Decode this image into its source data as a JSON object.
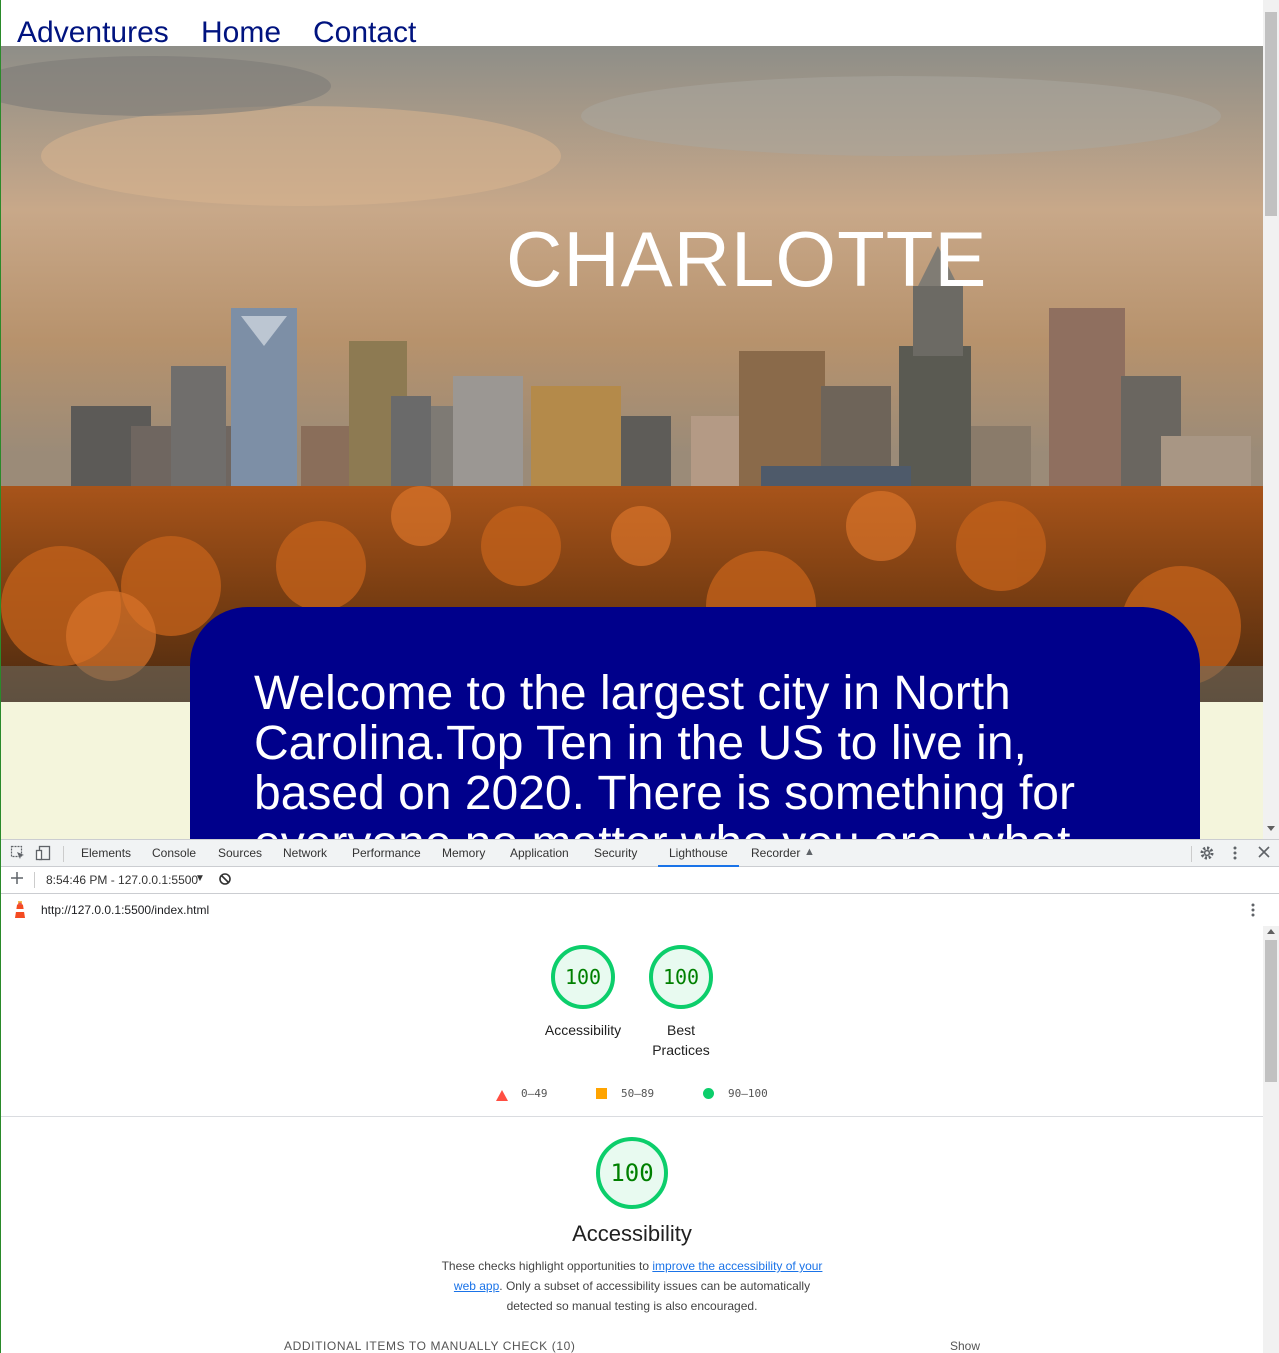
{
  "nav": {
    "adventures": "Adventures",
    "home": "Home",
    "contact": "Contact"
  },
  "hero": {
    "title": "CHARLOTTE"
  },
  "welcome": {
    "text": "Welcome to the largest city in North Carolina.Top Ten in the US to live in, based on 2020. There is something for everyone no matter who you are, what"
  },
  "devtools": {
    "tabs": [
      "Elements",
      "Console",
      "Sources",
      "Network",
      "Performance",
      "Memory",
      "Application",
      "Security",
      "Lighthouse",
      "Recorder"
    ],
    "active_tab": "Lighthouse",
    "report_select": "8:54:46 PM - 127.0.0.1:5500",
    "url": "http://127.0.0.1:5500/index.html"
  },
  "lighthouse": {
    "scores": [
      {
        "value": "100",
        "label": "Accessibility"
      },
      {
        "value": "100",
        "label_line1": "Best",
        "label_line2": "Practices"
      }
    ],
    "legend": {
      "fail": "0–49",
      "average": "50–89",
      "pass": "90–100"
    },
    "section_score": "100",
    "section_title": "Accessibility",
    "desc_before": "These checks highlight opportunities to ",
    "desc_link": "improve the accessibility of your web app",
    "desc_after": ". Only a subset of accessibility issues can be automatically detected so manual testing is also encouraged.",
    "manual_header": "ADDITIONAL ITEMS TO MANUALLY CHECK",
    "manual_count": "(10)",
    "show_label": "Show",
    "colors": {
      "pass": "#0cce6b",
      "average": "#ffa400",
      "fail": "#ff4e42"
    }
  }
}
